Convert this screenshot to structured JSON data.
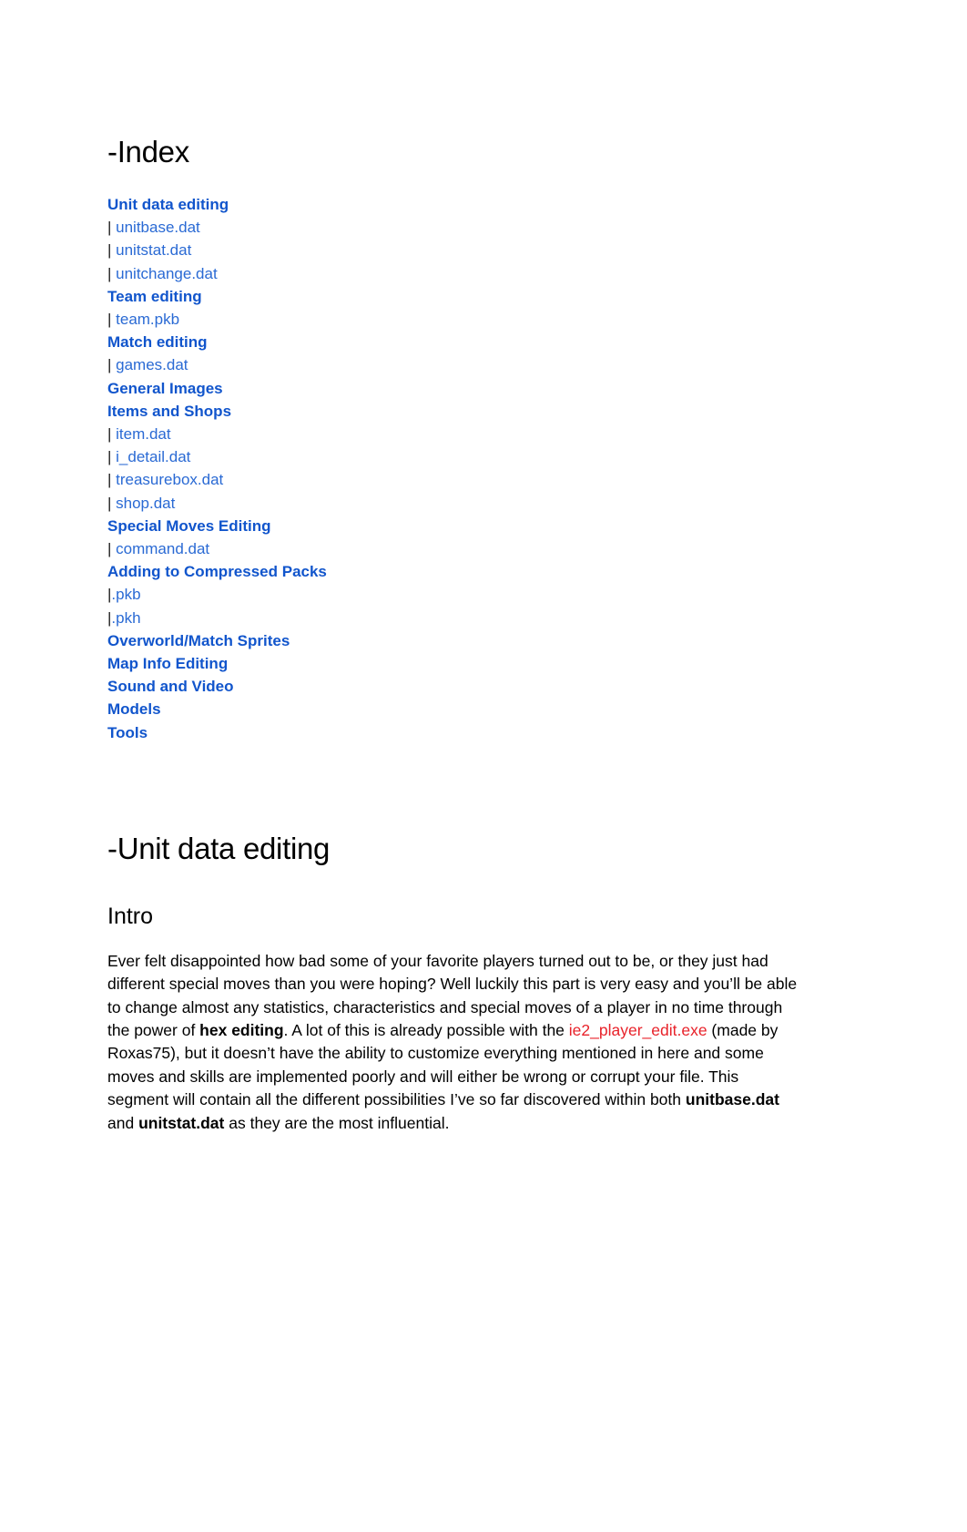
{
  "document": {
    "index_heading": "-Index",
    "index_items": [
      {
        "label": "Unit data editing",
        "type": "section"
      },
      {
        "label": "unitbase.dat",
        "type": "child",
        "prefix": "| "
      },
      {
        "label": "unitstat.dat",
        "type": "child",
        "prefix": "| "
      },
      {
        "label": "unitchange.dat",
        "type": "child",
        "prefix": "| "
      },
      {
        "label": "Team editing",
        "type": "section"
      },
      {
        "label": "team.pkb",
        "type": "child",
        "prefix": "| "
      },
      {
        "label": "Match editing",
        "type": "section"
      },
      {
        "label": "games.dat",
        "type": "child",
        "prefix": "| "
      },
      {
        "label": "General Images",
        "type": "section"
      },
      {
        "label": "Items and Shops",
        "type": "section"
      },
      {
        "label": "item.dat",
        "type": "child",
        "prefix": "| "
      },
      {
        "label": "i_detail.dat",
        "type": "child",
        "prefix": "| "
      },
      {
        "label": "treasurebox.dat",
        "type": "child",
        "prefix": "| "
      },
      {
        "label": "shop.dat",
        "type": "child",
        "prefix": "| "
      },
      {
        "label": "Special Moves Editing",
        "type": "section"
      },
      {
        "label": "command.dat",
        "type": "child",
        "prefix": "| "
      },
      {
        "label": "Adding to Compressed Packs",
        "type": "section"
      },
      {
        "label": ".pkb",
        "type": "child",
        "prefix": "|"
      },
      {
        "label": ".pkh",
        "type": "child",
        "prefix": "|"
      },
      {
        "label": "Overworld/Match Sprites",
        "type": "section"
      },
      {
        "label": "Map Info Editing",
        "type": "section"
      },
      {
        "label": "Sound and Video",
        "type": "section"
      },
      {
        "label": "Models",
        "type": "section"
      },
      {
        "label": "Tools",
        "type": "section"
      }
    ],
    "unit_data_heading": "-Unit data editing",
    "intro_heading": "Intro",
    "intro_paragraph": {
      "part1": "Ever felt disappointed how bad some of your favorite players turned out to be, or they just had different special moves than you were hoping? Well luckily this part is very easy and you’ll be able to change almost any statistics, characteristics and special moves of a player in no time through the power of ",
      "bold1": "hex editing",
      "part2": ". A lot of this is already possible with the ",
      "link1": "ie2_player_edit.exe",
      "part3": " (made by Roxas75), but it doesn’t have the ability to customize everything mentioned in here and some moves and skills are implemented poorly and will either be wrong or corrupt your file. This segment will contain all the different possibilities I’ve so far discovered within both ",
      "bold2": "unitbase.dat",
      "part4": " and ",
      "bold3": "unitstat.dat",
      "part5": " as they are the most influential."
    }
  },
  "colors": {
    "link_blue": "#1155cc",
    "child_link_blue": "#2a6ad4",
    "link_red": "#e8222a",
    "text_black": "#000000",
    "page_background": "#ffffff"
  }
}
